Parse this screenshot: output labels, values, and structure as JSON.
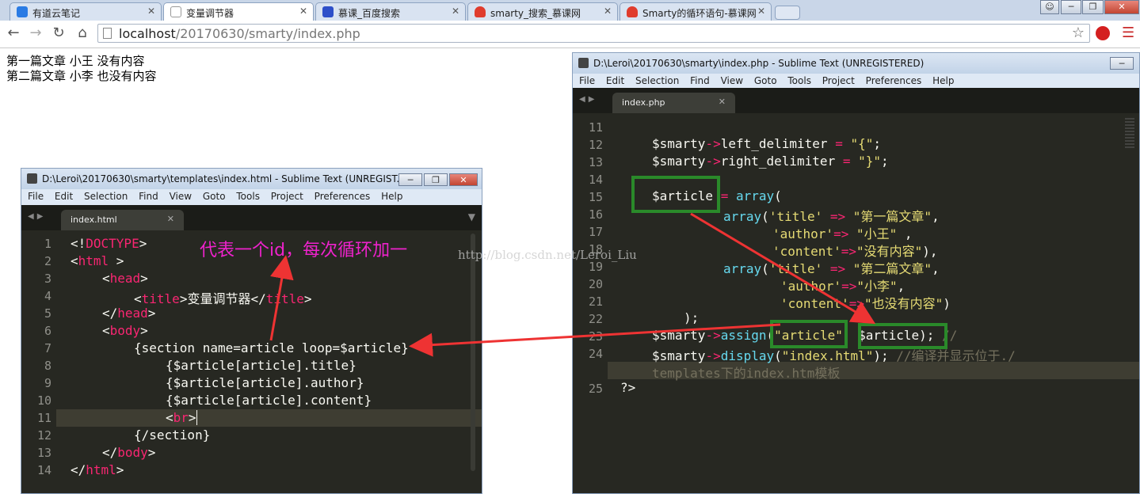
{
  "browser": {
    "tabs": [
      {
        "label": "有道云笔记",
        "icon_color": "#2a7be4"
      },
      {
        "label": "变量调节器",
        "icon_color": "#ffffff"
      },
      {
        "label": "慕课_百度搜索",
        "icon_color": "#2d4fc9"
      },
      {
        "label": "smarty_搜索_慕课网",
        "icon_color": "#e03c2d"
      },
      {
        "label": "Smarty的循环语句-慕课网",
        "icon_color": "#e03c2d"
      }
    ],
    "url_host": "localhost",
    "url_path": "/20170630/smarty/index.php"
  },
  "page_output": {
    "lines": [
      "第一篇文章 小王 没有内容",
      "第二篇文章 小李 也没有内容"
    ]
  },
  "left_editor": {
    "title": "D:\\Leroi\\20170630\\smarty\\templates\\index.html - Sublime Text (UNREGIST...",
    "menu": [
      "File",
      "Edit",
      "Selection",
      "Find",
      "View",
      "Goto",
      "Tools",
      "Project",
      "Preferences",
      "Help"
    ],
    "tab": "index.html",
    "line_numbers": [
      "1",
      "2",
      "3",
      "4",
      "5",
      "6",
      "7",
      "8",
      "9",
      "10",
      "11",
      "12",
      "13",
      "14"
    ],
    "code": {
      "l1a": "<!",
      "l1b": "DOCTYPE",
      "l1c": ">",
      "l2a": "<",
      "l2b": "html",
      "l2c": " >",
      "l3a": "<",
      "l3b": "head",
      "l3c": ">",
      "l4a": "<",
      "l4b": "title",
      "l4c": ">变量调节器</",
      "l4d": "title",
      "l4e": ">",
      "l5a": "</",
      "l5b": "head",
      "l5c": ">",
      "l6a": "<",
      "l6b": "body",
      "l6c": ">",
      "l7": "{section name=article loop=$article}",
      "l8": "{$article[article].title}",
      "l9": "{$article[article].author}",
      "l10": "{$article[article].content}",
      "l11a": "<",
      "l11b": "br",
      "l11c": ">",
      "l12": "{/section}",
      "l13a": "</",
      "l13b": "body",
      "l13c": ">",
      "l14a": "</",
      "l14b": "html",
      "l14c": ">"
    },
    "annotation": "代表一个id，每次循环加一"
  },
  "right_editor": {
    "title": "D:\\Leroi\\20170630\\smarty\\index.php - Sublime Text (UNREGISTERED)",
    "menu": [
      "File",
      "Edit",
      "Selection",
      "Find",
      "View",
      "Goto",
      "Tools",
      "Project",
      "Preferences",
      "Help"
    ],
    "tab": "index.php",
    "line_numbers": [
      "11",
      "12",
      "13",
      "14",
      "15",
      "16",
      "17",
      "18",
      "19",
      "20",
      "21",
      "22",
      "23",
      "24",
      "25"
    ],
    "code": {
      "l12a": "$smarty",
      "l12b": "->",
      "l12c": "left_delimiter",
      "l12d": " = ",
      "l12e": "\"{\"",
      "l12f": ";",
      "l13a": "$smarty",
      "l13b": "->",
      "l13c": "right_delimiter",
      "l13d": " = ",
      "l13e": "\"}\"",
      "l13f": ";",
      "l15a": "$article",
      "l15b": " = ",
      "l15c": "array",
      "l15d": "(",
      "l16a": "array",
      "l16b": "(",
      "l16c": "'title'",
      "l16d": " => ",
      "l16e": "\"第一篇文章\"",
      "l16f": ",",
      "l17a": "'author'",
      "l17b": "=>",
      "l17c": " \"小王\"",
      "l17d": " ,",
      "l18a": "'content'",
      "l18b": "=>",
      "l18c": "\"没有内容\"",
      "l18d": "),",
      "l19a": "array",
      "l19b": "(",
      "l19c": "'title'",
      "l19d": " => ",
      "l19e": "\"第二篇文章\"",
      "l19f": ",",
      "l20a": "'author'",
      "l20b": "=>",
      "l20c": "\"小李\"",
      "l20d": ",",
      "l21a": "'content'",
      "l21b": "=>",
      "l21c": "\"也没有内容\"",
      "l21d": ")",
      "l22": ");",
      "l23a": "$smarty",
      "l23b": "->",
      "l23c": "assign",
      "l23d": "(",
      "l23e": "\"article\"",
      "l23f": ", ",
      "l23g": "$article",
      "l23h": "); ",
      "l23i": "//",
      "l24a": "$smarty",
      "l24b": "->",
      "l24c": "display",
      "l24d": "(",
      "l24e": "\"index.html\"",
      "l24f": "); ",
      "l24g": "//编译并显示位于./",
      "l24h": "templates下的index.htm模板",
      "l25": "?>"
    }
  },
  "watermark": "http://blog.csdn.net/Leroi_Liu",
  "colors": {
    "editor_bg": "#272822",
    "keyword": "#f92672",
    "string": "#e6db74",
    "function": "#66d9ef",
    "comment": "#75715e",
    "highlight_box": "#2a8a2a",
    "arrow": "#ee3333",
    "annotation": "#ee22cc"
  }
}
